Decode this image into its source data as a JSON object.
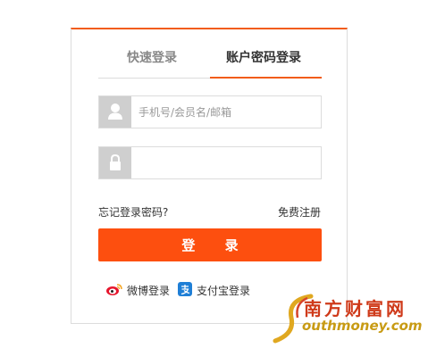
{
  "tabs": [
    {
      "label": "快速登录",
      "active": false
    },
    {
      "label": "账户密码登录",
      "active": true
    }
  ],
  "username": {
    "placeholder": "手机号/会员名/邮箱",
    "value": ""
  },
  "password": {
    "placeholder": "",
    "value": ""
  },
  "links": {
    "forgot": "忘记登录密码?",
    "register": "免费注册"
  },
  "login_button": "登 录",
  "social": [
    {
      "label": "微博登录",
      "icon": "weibo-icon"
    },
    {
      "label": "支付宝登录",
      "icon": "alipay-icon"
    }
  ],
  "watermark": {
    "cn": "南方财富网",
    "en": "outhmoney.com"
  },
  "colors": {
    "accent": "#f25c19",
    "button": "#fd4f0f",
    "icon_bg": "#cfcfcf"
  }
}
